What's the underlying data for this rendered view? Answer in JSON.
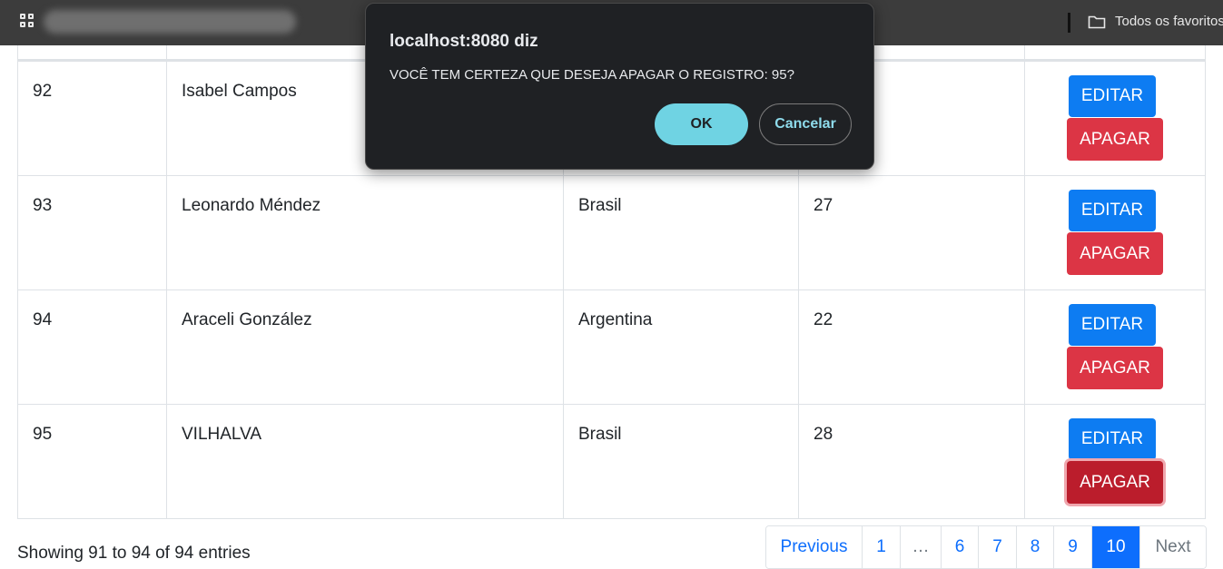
{
  "browser": {
    "favorites_label": "Todos os favoritos"
  },
  "dialog": {
    "title": "localhost:8080 diz",
    "message": "VOCÊ TEM CERTEZA QUE DESEJA APAGAR O REGISTRO: 95?",
    "ok_label": "OK",
    "cancel_label": "Cancelar",
    "ok_color": "#6fd3e3"
  },
  "table": {
    "rows": [
      {
        "id": "92",
        "name": "Isabel Campos",
        "country": "",
        "age": ""
      },
      {
        "id": "93",
        "name": "Leonardo Méndez",
        "country": "Brasil",
        "age": "27"
      },
      {
        "id": "94",
        "name": "Araceli González",
        "country": "Argentina",
        "age": "22"
      },
      {
        "id": "95",
        "name": "VILHALVA",
        "country": "Brasil",
        "age": "28"
      }
    ],
    "edit_label": "EDITAR",
    "delete_label": "APAGAR",
    "edit_color": "#0d7cf2",
    "delete_color": "#dc3545"
  },
  "footer": {
    "info": "Showing 91 to 94 of 94 entries",
    "pages": {
      "previous": "Previous",
      "p1": "1",
      "ellipsis": "…",
      "p6": "6",
      "p7": "7",
      "p8": "8",
      "p9": "9",
      "p10": "10",
      "next": "Next"
    },
    "current_page": "10"
  }
}
